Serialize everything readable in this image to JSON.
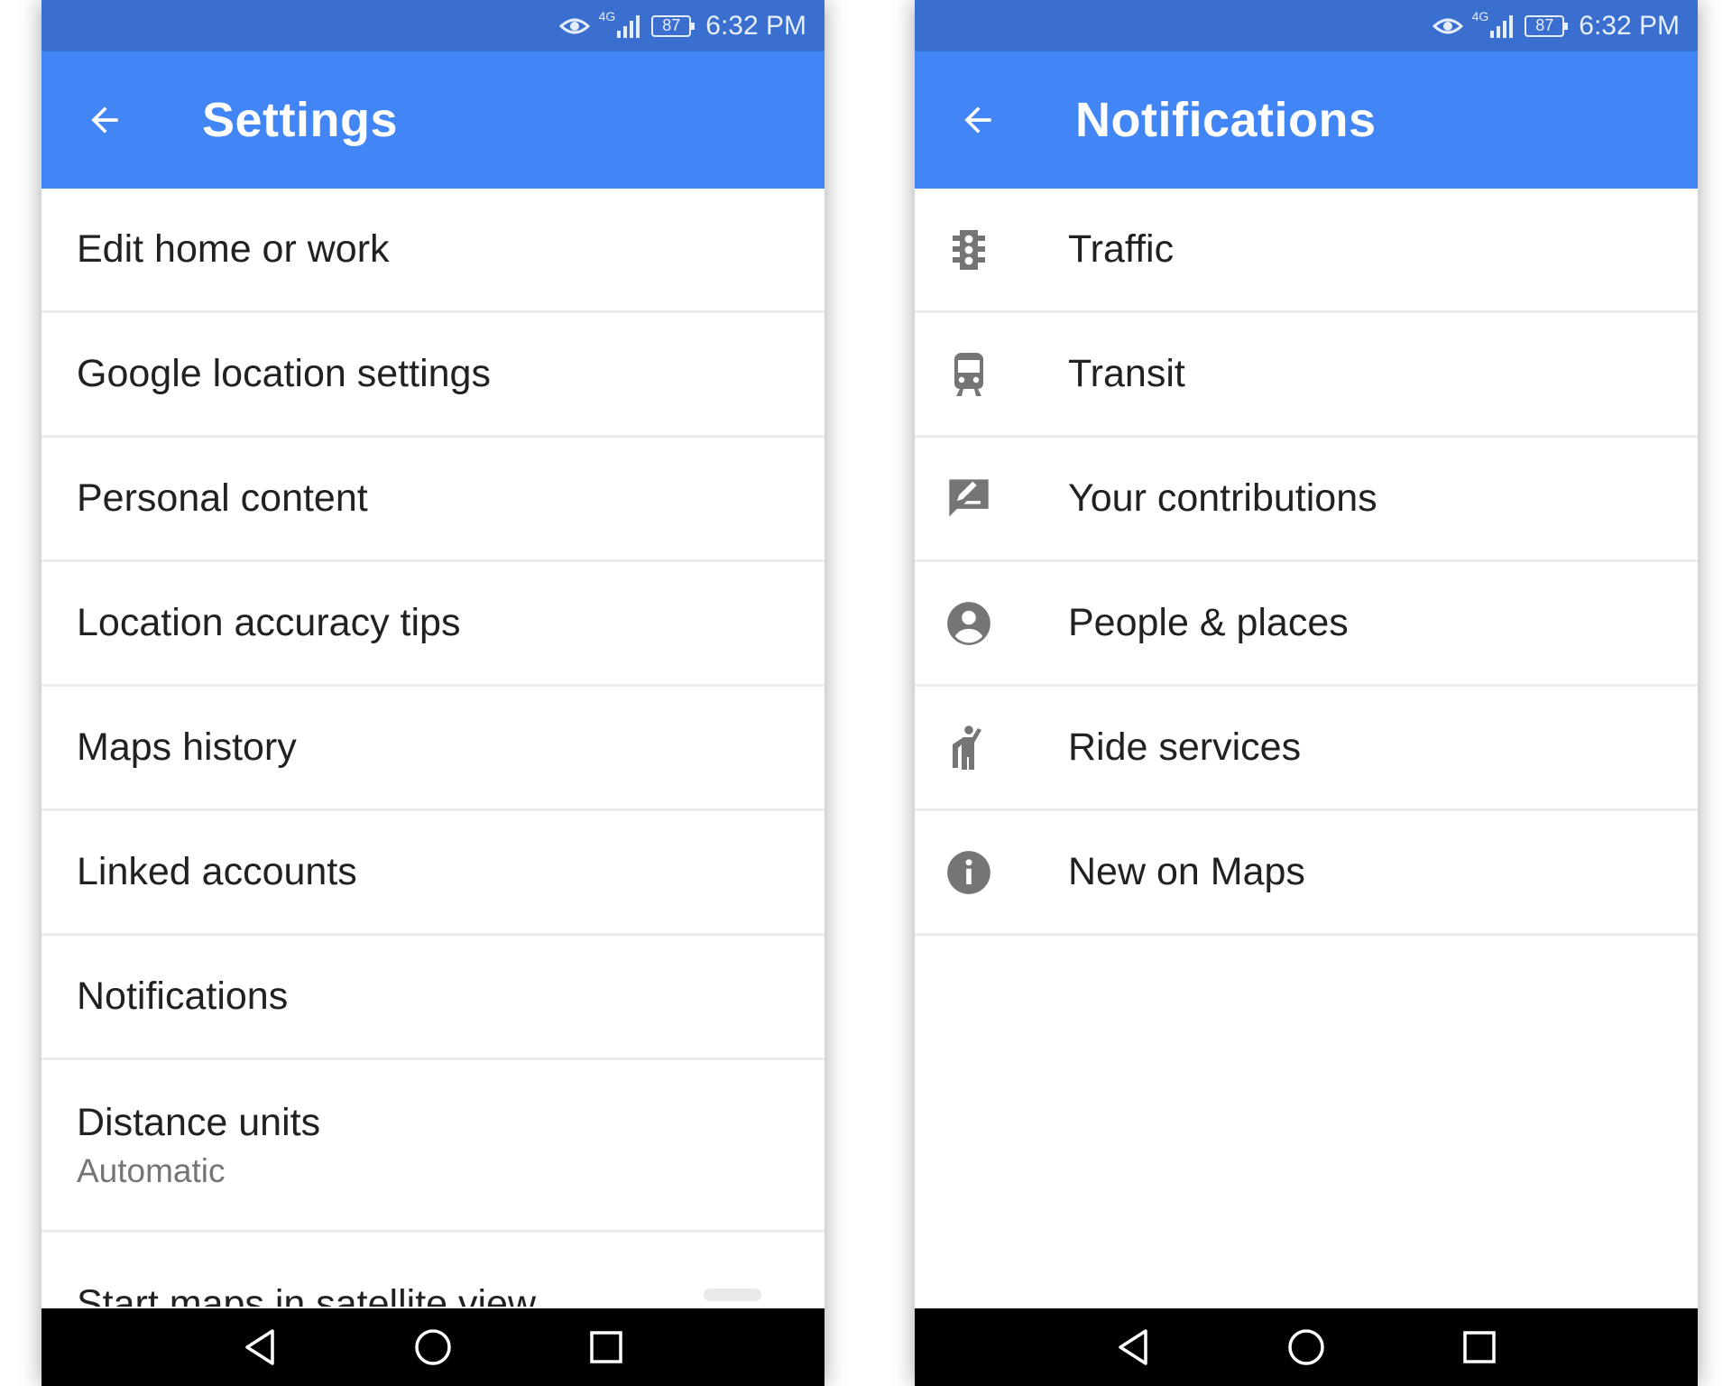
{
  "status_bar": {
    "network": "4G",
    "battery": "87",
    "time": "6:32 PM"
  },
  "settings": {
    "title": "Settings",
    "items": [
      {
        "label": "Edit home or work"
      },
      {
        "label": "Google location settings"
      },
      {
        "label": "Personal content"
      },
      {
        "label": "Location accuracy tips"
      },
      {
        "label": "Maps history"
      },
      {
        "label": "Linked accounts"
      },
      {
        "label": "Notifications"
      },
      {
        "label": "Distance units",
        "sub": "Automatic"
      },
      {
        "label": "Start maps in satellite view"
      }
    ]
  },
  "notifications": {
    "title": "Notifications",
    "items": [
      {
        "label": "Traffic",
        "icon": "traffic-light-icon"
      },
      {
        "label": "Transit",
        "icon": "train-icon"
      },
      {
        "label": "Your contributions",
        "icon": "rate-review-icon"
      },
      {
        "label": "People & places",
        "icon": "account-circle-icon"
      },
      {
        "label": "Ride services",
        "icon": "hail-icon"
      },
      {
        "label": "New on Maps",
        "icon": "info-icon"
      }
    ]
  },
  "colors": {
    "status_bar": "#3a6fd0",
    "app_bar": "#4285f4",
    "icon_gray": "#757575",
    "text": "#212121",
    "subtext": "#757575"
  }
}
